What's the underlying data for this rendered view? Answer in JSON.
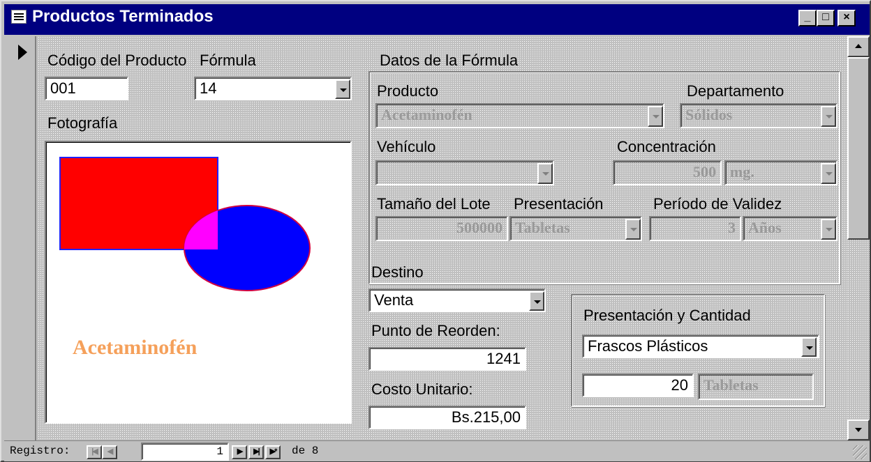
{
  "window": {
    "title": "Productos Terminados"
  },
  "title_buttons": {
    "minimize": "_",
    "maximize": "□",
    "close": "×"
  },
  "form": {
    "codigo_label": "Código del Producto",
    "codigo_value": "001",
    "formula_label": "Fórmula",
    "formula_value": "14",
    "foto_label": "Fotografía",
    "foto_caption": "Acetaminofén",
    "datos_label": "Datos de la Fórmula",
    "producto_label": "Producto",
    "producto_value": "Acetaminofén",
    "departamento_label": "Departamento",
    "departamento_value": "Sólidos",
    "vehiculo_label": "Vehículo",
    "vehiculo_value": "",
    "concentracion_label": "Concentración",
    "concentracion_value": "500",
    "concentracion_unit": "mg.",
    "lote_label": "Tamaño del Lote",
    "lote_value": "500000",
    "presentacion_label": "Presentación",
    "presentacion_value": "Tabletas",
    "validez_label": "Período de Validez",
    "validez_value": "3",
    "validez_unit": "Años",
    "destino_label": "Destino",
    "destino_value": "Venta",
    "reorden_label": "Punto de Reorden:",
    "reorden_value": "1241",
    "costo_label": "Costo Unitario:",
    "costo_value": "Bs.215,00",
    "pyc_label": "Presentación y Cantidad",
    "pyc_envase_value": "Frascos Plásticos",
    "pyc_cantidad_value": "20",
    "pyc_unidad_value": "Tabletas"
  },
  "navigation": {
    "registro_label": "Registro:",
    "current_record": "1",
    "of_label": "de 8"
  },
  "colors": {
    "titlebar": "#000080",
    "caption": "#f5a05a",
    "rect": "#ff0000",
    "ellipse": "#0000ff",
    "overlap": "#ff00ff"
  }
}
